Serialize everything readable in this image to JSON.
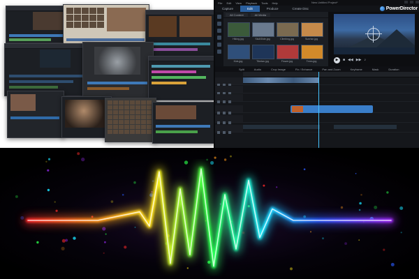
{
  "powerdirector": {
    "brand": "PowerDirector",
    "project_name": "New Untitled Project*",
    "menu": [
      "File",
      "Edit",
      "View",
      "Playback",
      "Tools",
      "Help"
    ],
    "tabs": [
      "Capture",
      "Edit",
      "Produce",
      "Create Disc"
    ],
    "active_tab": "Edit",
    "library_filter": "All Content",
    "library_sort": "All Media",
    "library_items": [
      "Hiking.jpg",
      "Ski&Slide.jpg",
      "Climbing.jpg",
      "Sunrise.jpg",
      "Kids.jpg",
      "Tibetan.jpg",
      "Flower.jpg",
      "Trees.jpg"
    ],
    "tools": [
      "Split",
      "Audio",
      "Crop Image",
      "Fix / Enhance",
      "Pan and Zoom",
      "Keyframe",
      "Mask",
      "Duration"
    ],
    "timeline_label": "Title.jpg"
  },
  "colors": {
    "accent": "#2a5f9e",
    "clip_blue": "#3a7ec9",
    "playhead": "#45c3ff",
    "waveform_gradient": [
      "#ff2a2a",
      "#ff9a1a",
      "#ffe81a",
      "#2bff4a",
      "#19e3ff",
      "#2b5bff",
      "#a12bff"
    ]
  },
  "waveform": {
    "style": "rainbow-heartbeat",
    "levels": [
      0.0,
      0.0,
      0.15,
      -0.1,
      0.85,
      -0.75,
      0.55,
      -0.6,
      0.9,
      -0.8,
      0.45,
      -0.5,
      0.7,
      -0.3,
      0.2,
      0.0,
      0.0
    ]
  }
}
